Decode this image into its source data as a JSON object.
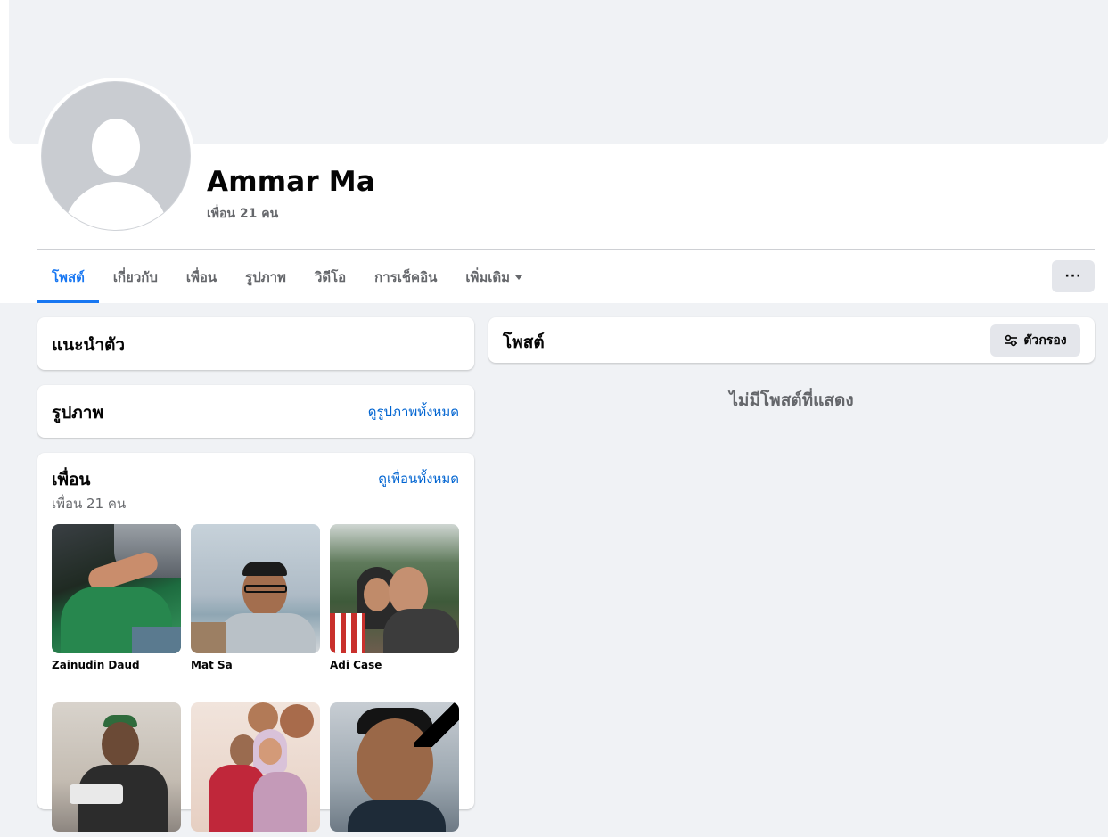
{
  "profile": {
    "name": "Ammar Ma",
    "friend_count": "เพื่อน 21 คน"
  },
  "tabs": [
    {
      "label": "โพสต์",
      "active": true
    },
    {
      "label": "เกี่ยวกับ"
    },
    {
      "label": "เพื่อน"
    },
    {
      "label": "รูปภาพ"
    },
    {
      "label": "วิดีโอ"
    },
    {
      "label": "การเช็คอิน"
    },
    {
      "label": "เพิ่มเติม"
    }
  ],
  "more_button_label": "···",
  "intro": {
    "title": "แนะนำตัว"
  },
  "photos": {
    "title": "รูปภาพ",
    "see_all": "ดูรูปภาพทั้งหมด"
  },
  "friends": {
    "title": "เพื่อน",
    "count": "เพื่อน 21 คน",
    "see_all": "ดูเพื่อนทั้งหมด",
    "items": [
      {
        "name": "Zainudin Daud"
      },
      {
        "name": "Mat Sa"
      },
      {
        "name": "Adi Case"
      },
      {
        "name": ""
      },
      {
        "name": ""
      },
      {
        "name": ""
      }
    ]
  },
  "posts": {
    "title": "โพสต์",
    "filter_label": "ตัวกรอง",
    "empty_message": "ไม่มีโพสต์ที่แสดง"
  },
  "colors": {
    "accent": "#1877f2",
    "link": "#0064d1",
    "background": "#f0f2f5",
    "secondary_text": "#65676b"
  }
}
